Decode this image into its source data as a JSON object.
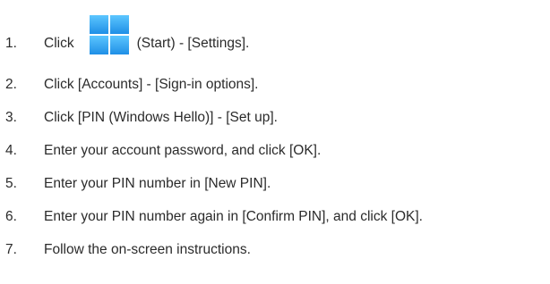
{
  "steps": [
    {
      "number": "1.",
      "pre": "Click",
      "icon": "windows-start-icon",
      "post": "(Start) - [Settings]."
    },
    {
      "number": "2.",
      "text": "Click [Accounts] - [Sign-in options]."
    },
    {
      "number": "3.",
      "text": "Click [PIN (Windows Hello)] - [Set up]."
    },
    {
      "number": "4.",
      "text": "Enter your account password, and click [OK]."
    },
    {
      "number": "5.",
      "text": "Enter your PIN number in [New PIN]."
    },
    {
      "number": "6.",
      "text": "Enter your PIN number again in [Confirm PIN], and click [OK]."
    },
    {
      "number": "7.",
      "text": "Follow the on-screen instructions."
    }
  ],
  "colors": {
    "text": "#2b2b2b",
    "icon_top": "#5cc6ff",
    "icon_bottom": "#1f8fe6"
  }
}
